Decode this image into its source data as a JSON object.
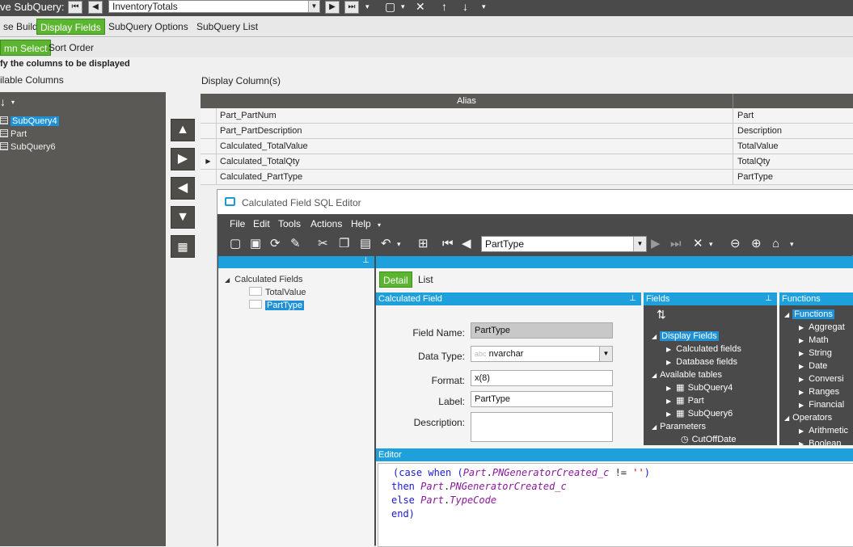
{
  "top": {
    "label": "ve SubQuery:",
    "subquery_value": "InventoryTotals"
  },
  "tabs": [
    "se Build",
    "Display Fields",
    "SubQuery Options",
    "SubQuery List"
  ],
  "subtabs": [
    "mn Select",
    "Sort Order"
  ],
  "hint": "fy the columns to be displayed",
  "available_label": "ilable Columns",
  "display_label": "Display Column(s)",
  "available": [
    "SubQuery4",
    "Part",
    "SubQuery6"
  ],
  "grid": {
    "header_alias": "Alias",
    "rows": [
      {
        "col": "Part_PartNum",
        "alias": "Part"
      },
      {
        "col": "Part_PartDescription",
        "alias": "Description"
      },
      {
        "col": "Calculated_TotalValue",
        "alias": "TotalValue"
      },
      {
        "col": "Calculated_TotalQty",
        "alias": "TotalQty"
      },
      {
        "col": "Calculated_PartType",
        "alias": "PartType"
      }
    ]
  },
  "editor": {
    "title": "Calculated Field SQL Editor",
    "menu": [
      "File",
      "Edit",
      "Tools",
      "Actions",
      "Help"
    ],
    "combo_value": "PartType",
    "tree": {
      "root": "Calculated Fields",
      "items": [
        "TotalValue",
        "PartType"
      ]
    },
    "detail_tabs": [
      "Detail",
      "List"
    ],
    "calc_panel_title": "Calculated Field",
    "form": {
      "field_name_label": "Field Name:",
      "field_name": "PartType",
      "data_type_label": "Data Type:",
      "data_type_prefix": "abc",
      "data_type": "nvarchar",
      "format_label": "Format:",
      "format": "x(8)",
      "label_label": "Label:",
      "label": "PartType",
      "description_label": "Description:"
    },
    "fields_panel": {
      "title": "Fields",
      "rows": [
        "Display Fields",
        "Calculated fields",
        "Database fields",
        "Available tables",
        "SubQuery4",
        "Part",
        "SubQuery6",
        "Parameters",
        "CutOffDate"
      ]
    },
    "functions_panel": {
      "title": "Functions",
      "rows": [
        "Functions",
        "Aggregat",
        "Math",
        "String",
        "Date",
        "Conversi",
        "Ranges",
        "Financial",
        "Operators",
        "Arithmetic",
        "Boolean"
      ]
    },
    "editor_panel_title": "Editor",
    "code": {
      "l1a": "(case when (",
      "l1b": "Part",
      "l1c": ".",
      "l1d": "PNGeneratorCreated_c",
      "l1e": " != ",
      "l1f": "''",
      "l1g": ")",
      "l2a": "then ",
      "l2b": "Part",
      "l2c": ".",
      "l2d": "PNGeneratorCreated_c",
      "l3a": "else ",
      "l3b": "Part",
      "l3c": ".",
      "l3d": "TypeCode",
      "l4": "end)"
    }
  }
}
